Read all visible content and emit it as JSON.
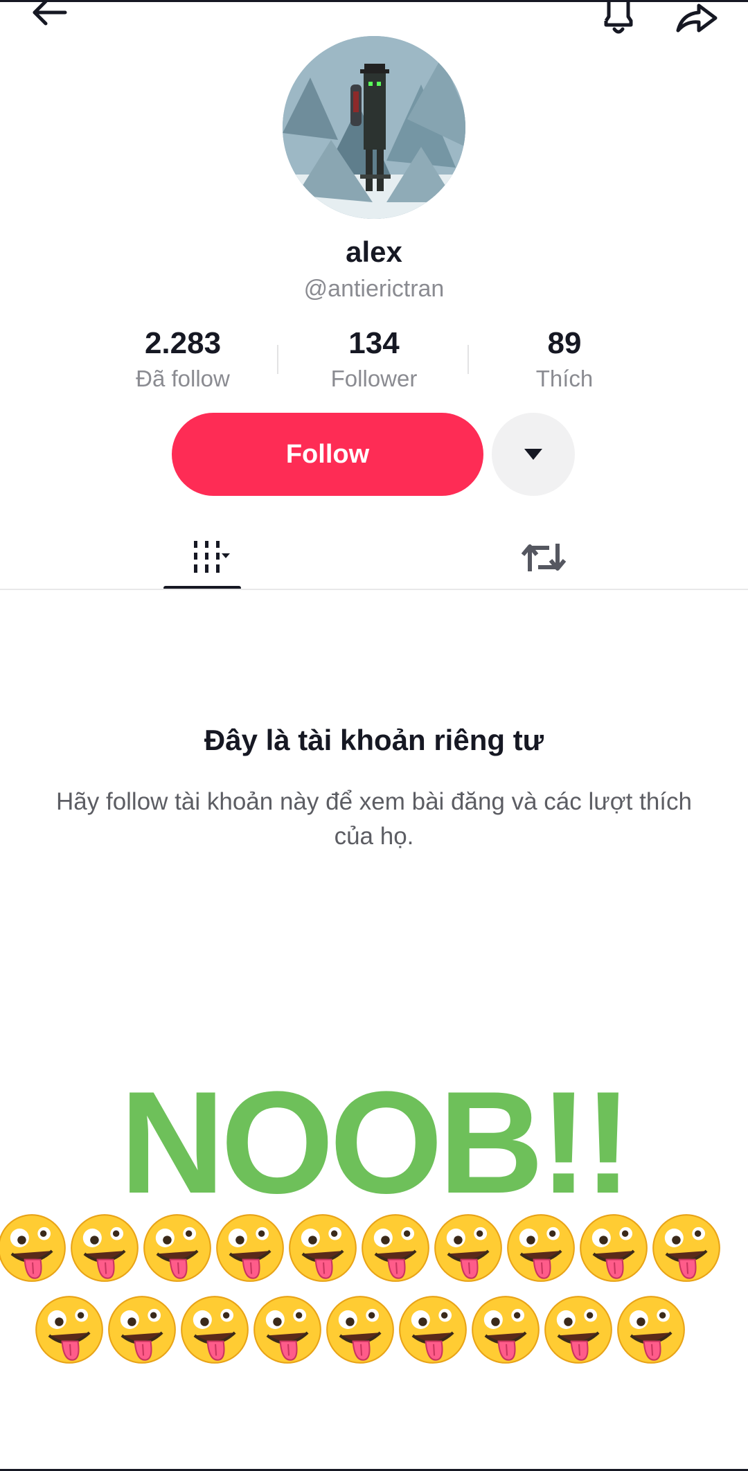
{
  "profile": {
    "display_name": "alex",
    "handle": "@antierictran"
  },
  "stats": {
    "following": {
      "value": "2.283",
      "label": "Đã follow"
    },
    "followers": {
      "value": "134",
      "label": "Follower"
    },
    "likes": {
      "value": "89",
      "label": "Thích"
    }
  },
  "actions": {
    "follow_label": "Follow"
  },
  "private_notice": {
    "title": "Đây là tài khoản riêng tư",
    "description": "Hãy follow tài khoản này để xem bài đăng và các lượt thích của họ."
  },
  "overlay": {
    "caption": "NOOB!!",
    "emoji": "zany-face",
    "emoji_row_counts": [
      10,
      9
    ]
  },
  "colors": {
    "follow_button": "#fe2c55",
    "caption_green": "#6ec05a",
    "secondary_text": "#8a8b91"
  },
  "icons": {
    "back": "arrow-left-icon",
    "notifications": "bell-icon",
    "share": "share-arrow-icon",
    "more": "caret-down-icon",
    "videos_tab": "grid-icon",
    "reposts_tab": "repost-icon"
  }
}
